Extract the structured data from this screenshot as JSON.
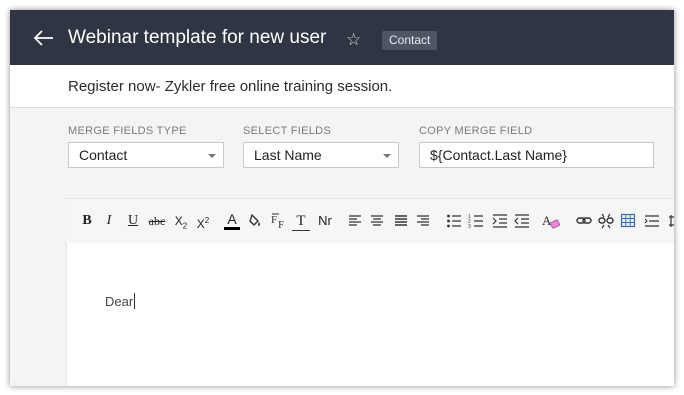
{
  "header": {
    "title": "Webinar template for new user",
    "badge": "Contact"
  },
  "subject": "Register now- Zykler free online training session.",
  "merge": {
    "type_label": "MERGE FIELDS TYPE",
    "type_value": "Contact",
    "select_label": "SELECT FIELDS",
    "select_value": "Last Name",
    "copy_label": "COPY MERGE FIELD",
    "copy_value": "${Contact.Last Name}"
  },
  "toolbar": {
    "bold": "B",
    "italic": "I",
    "underline": "U",
    "strike": "abc",
    "subscript_base": "X",
    "subscript_mark": "2",
    "superscript_base": "X",
    "superscript_mark": "2",
    "font_color": "A",
    "font_size": "T",
    "normal_text": "Nr"
  },
  "editor": {
    "text": "Dear"
  },
  "colors": {
    "header_bg": "#2f3542",
    "badge_bg": "#4e5565",
    "page_bg": "#f4f4f4"
  },
  "icons": [
    "back-arrow-icon",
    "star-icon",
    "bold-icon",
    "italic-icon",
    "underline-icon",
    "strikethrough-icon",
    "subscript-icon",
    "superscript-icon",
    "font-color-icon",
    "highlight-color-icon",
    "font-family-icon",
    "font-size-icon",
    "normal-text-icon",
    "align-left-icon",
    "align-center-icon",
    "align-justify-icon",
    "align-right-icon",
    "bullet-list-icon",
    "numbered-list-icon",
    "indent-icon",
    "outdent-icon",
    "clear-format-icon",
    "link-icon",
    "unlink-icon",
    "table-icon",
    "more-icon"
  ]
}
